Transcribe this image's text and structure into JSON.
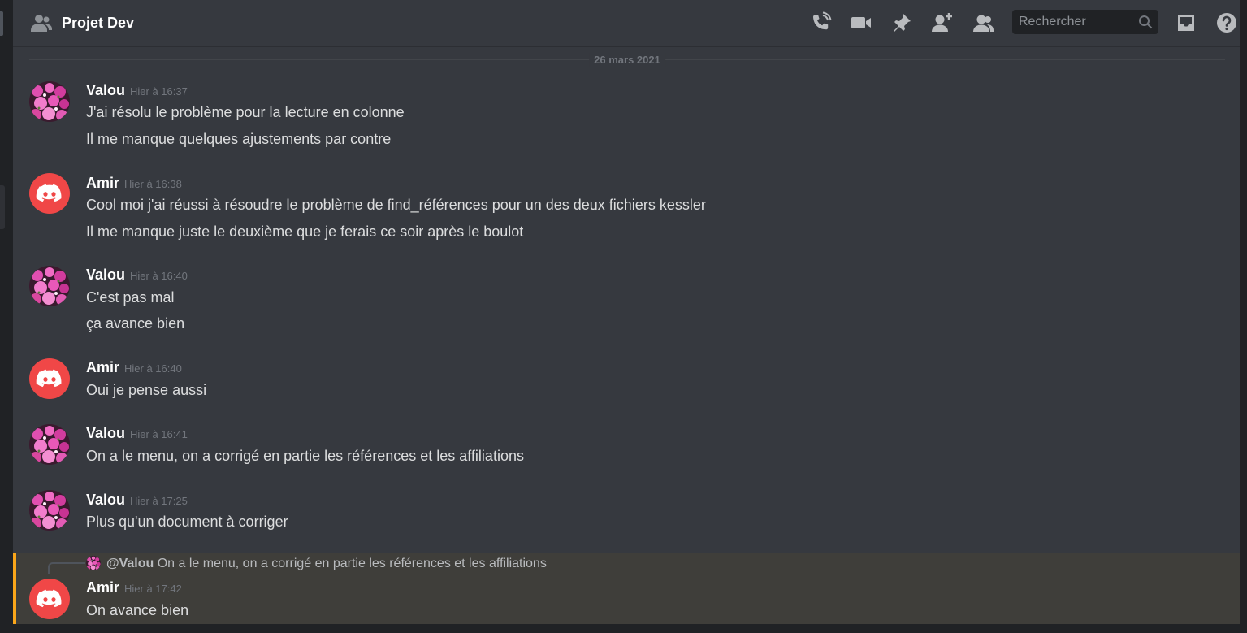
{
  "colors": {
    "accent_reply": "#faa61a",
    "background": "#36393f",
    "discord_red": "#f04747"
  },
  "header": {
    "channel_icon": "group-dm-icon",
    "title": "Projet Dev",
    "search_placeholder": "Rechercher",
    "icons": [
      "voice-call-icon",
      "video-call-icon",
      "pin-icon",
      "add-member-icon",
      "member-list-icon",
      "search-icon",
      "inbox-icon",
      "help-icon"
    ]
  },
  "divider": {
    "date": "26 mars 2021"
  },
  "messages": [
    {
      "author": "Valou",
      "timestamp": "Hier à 16:37",
      "avatar": "flower-avatar",
      "lines": [
        "J'ai résolu le problème pour la lecture en colonne",
        "Il me manque quelques ajustements par contre"
      ]
    },
    {
      "author": "Amir",
      "timestamp": "Hier à 16:38",
      "avatar": "discord-logo-avatar",
      "lines": [
        "Cool moi j'ai réussi à résoudre le problème de find_références pour  un des deux fichiers kessler",
        "Il me manque juste le deuxième que je ferais ce soir après le boulot"
      ]
    },
    {
      "author": "Valou",
      "timestamp": "Hier à 16:40",
      "avatar": "flower-avatar",
      "lines": [
        "C'est pas mal",
        "ça avance bien"
      ]
    },
    {
      "author": "Amir",
      "timestamp": "Hier à 16:40",
      "avatar": "discord-logo-avatar",
      "lines": [
        "Oui je pense aussi"
      ]
    },
    {
      "author": "Valou",
      "timestamp": "Hier à 16:41",
      "avatar": "flower-avatar",
      "lines": [
        "On a le menu, on a corrigé en partie les références et les affiliations"
      ]
    },
    {
      "author": "Valou",
      "timestamp": "Hier à 17:25",
      "avatar": "flower-avatar",
      "lines": [
        "Plus qu'un document à corriger"
      ]
    },
    {
      "author": "Amir",
      "timestamp": "Hier à 17:42",
      "avatar": "discord-logo-avatar",
      "reply_to": {
        "mention": "@Valou",
        "text": "On a le menu, on a corrigé en partie les références et les affiliations"
      },
      "lines": [
        "On avance bien"
      ]
    }
  ]
}
